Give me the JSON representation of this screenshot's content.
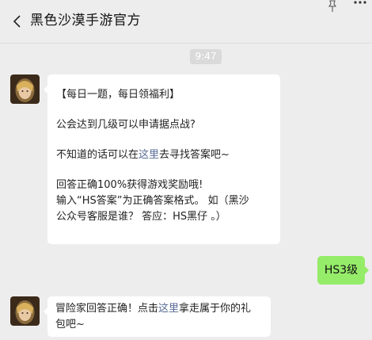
{
  "header": {
    "title": "黑色沙漠手游官方"
  },
  "timestamp": "9:47",
  "messages": {
    "first": {
      "line1": "【每日一题，每日领福利】",
      "line2": "公会达到几级可以申请据点战?",
      "line3_pre": "不知道的话可以在",
      "line3_link": "这里",
      "line3_post": "去寻找答案吧~",
      "line4": "回答正确100%获得游戏奖励哦!",
      "line5": "输入“HS答案”为正确答案格式。 如（黑沙",
      "line6": "公众号客服是谁？ 答应：HS黑仔 。）"
    },
    "reply": "HS3级",
    "second": {
      "line1_pre": "冒险家回答正确！点击",
      "line1_link": "这里",
      "line1_post": "拿走属于你的礼",
      "line2": "包吧~"
    }
  },
  "colors": {
    "background": "#ededed",
    "my_bubble": "#95ec69",
    "link": "#576b95"
  },
  "icons": [
    "back-arrow-icon",
    "pin-icon",
    "more-icon"
  ]
}
